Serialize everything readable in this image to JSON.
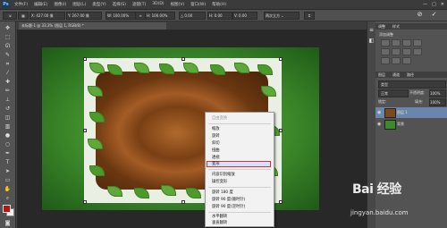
{
  "app": {
    "logo": "Ps"
  },
  "menubar": {
    "items": [
      "文件(F)",
      "编辑(E)",
      "图像(I)",
      "图层(L)",
      "类型(Y)",
      "选择(S)",
      "滤镜(T)",
      "3D(D)",
      "视图(V)",
      "窗口(W)",
      "帮助(H)"
    ],
    "window_controls": [
      "—",
      "□",
      "✕"
    ]
  },
  "options": {
    "x": "X: 427.00 像",
    "y": "Y: 267.00 像",
    "w": "W: 100.00%",
    "h": "H: 100.00%",
    "angle": "△ 0.00",
    "h_skew": "H: 0.00",
    "v_skew": "V: 0.00",
    "interpolation": "两次立方 ⌄",
    "commit": "✓",
    "cancel": "⊘"
  },
  "document": {
    "tab_title": "未标题-1 @ 33.3% (图层 1, RGB/8) *"
  },
  "context_menu": {
    "items": [
      {
        "label": "自由变换",
        "enabled": false
      },
      {
        "label": "缩放",
        "enabled": true
      },
      {
        "label": "旋转",
        "enabled": true
      },
      {
        "label": "斜切",
        "enabled": true
      },
      {
        "label": "扭曲",
        "enabled": true
      },
      {
        "label": "透视",
        "enabled": true
      },
      {
        "label": "变形",
        "enabled": true,
        "highlighted": true
      },
      {
        "label": "内容识别缩放",
        "enabled": true
      },
      {
        "label": "操控变形",
        "enabled": true
      },
      {
        "label": "旋转 180 度",
        "enabled": true
      },
      {
        "label": "旋转 90 度(顺时针)",
        "enabled": true
      },
      {
        "label": "旋转 90 度(逆时针)",
        "enabled": true
      },
      {
        "label": "水平翻转",
        "enabled": true
      },
      {
        "label": "垂直翻转",
        "enabled": true
      }
    ]
  },
  "panels": {
    "adjust_tabs": [
      "调整",
      "样式"
    ],
    "adjust_title": "添加调整",
    "layers_tabs": [
      "图层",
      "通道",
      "路径"
    ],
    "kind_label": "类型",
    "blend_mode": "正常",
    "opacity_label": "不透明度:",
    "opacity_value": "100%",
    "lock_label": "锁定:",
    "fill_label": "填充:",
    "fill_value": "100%",
    "layers": [
      {
        "name": "图层 1",
        "selected": true
      },
      {
        "name": "背景",
        "selected": false
      }
    ]
  },
  "watermark": {
    "logo": "Bai 经验",
    "url": "jingyan.baidu.com"
  },
  "colors": {
    "foreground": "#b01818",
    "background": "#f3f3f3",
    "highlight_border": "#d23434"
  }
}
